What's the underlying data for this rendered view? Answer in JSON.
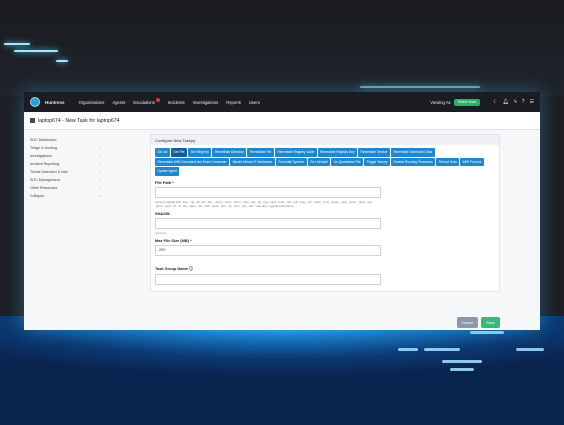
{
  "header": {
    "brand": "Huntress",
    "nav": [
      "Organizations",
      "Agents",
      "Escalations",
      "Incidents",
      "Investigations",
      "Reports",
      "Users"
    ],
    "viewing_as": "Viewing As",
    "select_label": "Select User"
  },
  "page": {
    "title": "laptop674 - New Task for laptop674"
  },
  "sidebar": {
    "items": [
      {
        "label": "SOC Dashboard"
      },
      {
        "label": "Triage & Hunting"
      },
      {
        "label": "Investigations"
      },
      {
        "label": "Incident Reporting"
      },
      {
        "label": "Threat Detection & Intel"
      },
      {
        "label": "SOC Management"
      },
      {
        "label": "Other Resources"
      },
      {
        "label": "Collapse"
      }
    ]
  },
  "panel": {
    "title": "Configure New Task(s)",
    "tabs": [
      "Dir List",
      "Get File",
      "Get Reg Key",
      "Remediate Directory",
      "Remediate File",
      "Remediate Registry Value",
      "Remediate Registry Key",
      "Remediate Service",
      "Remediate Scheduled Task",
      "Remediate WMI Command-line Event Consumer",
      "Block/Unblock IP Addresses",
      "Re-Install Sysmon",
      "Re-Uninstall",
      "Un-Quarantine File",
      "Trigger Survey",
      "Restrict Running Processes",
      "Reboot Host",
      "WMI Process",
      "Update Agent"
    ],
    "active_tab": "Get File",
    "file_path_label": "File Path *",
    "file_path_value": "",
    "file_path_help": "Cannot GetFile with .exe, .zip, .dll, .sh, .doc, .docm, .docx, .dotm, .dotx, .dot, .gif, .jpg, .mp3, .mp4, .odt, .pdf, .png, .pot, .potm, .potx, .ppam, .pps, .ppsm, .ppsx, .ppt, .pptm, .pptx, .rtf, .xl, .xla, .xlam, .xls, .xlsb, .xlsm, .xlsx, .xlt, .xltm, .xltx, .xlw, .wav and .ogg file extensions.",
    "sha256_label": "SHA256",
    "sha256_value": "",
    "sha256_hint": "optional",
    "max_size_label": "Max File Size (MB) *",
    "max_size_value": "200",
    "task_group_label": "Task Group Name ⓘ",
    "task_group_value": ""
  },
  "buttons": {
    "cancel": "Cancel",
    "save": "Save"
  },
  "colors": {
    "tab": "#1f86d1",
    "save": "#39b879",
    "cancel": "#8c99a6",
    "topbar": "#1b1d22"
  }
}
